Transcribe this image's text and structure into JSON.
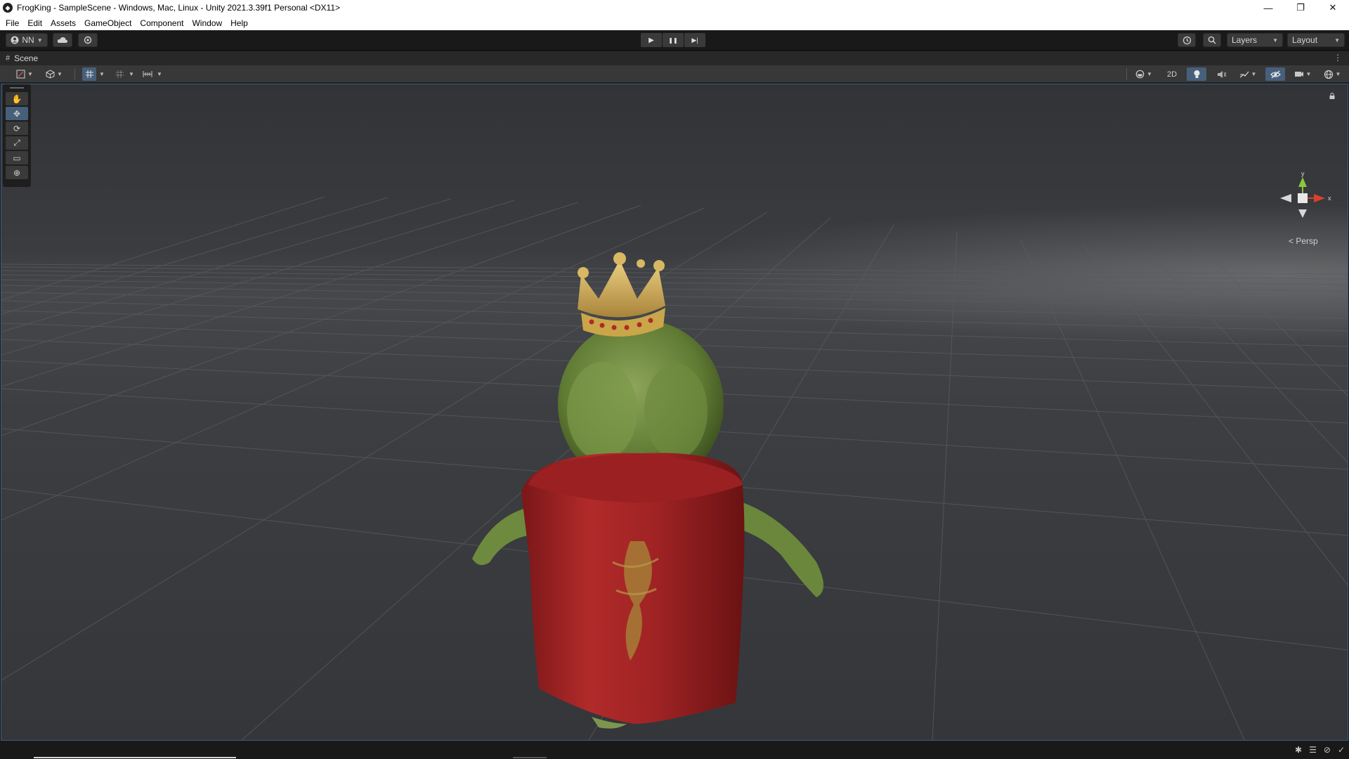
{
  "window": {
    "title": "FrogKing - SampleScene - Windows, Mac, Linux - Unity 2021.3.39f1 Personal <DX11>",
    "controls": {
      "minimize": "—",
      "restore": "❐",
      "close": "✕"
    }
  },
  "menu": [
    "File",
    "Edit",
    "Assets",
    "GameObject",
    "Component",
    "Window",
    "Help"
  ],
  "toolbar": {
    "account_label": "NN",
    "play_icons": {
      "play": "▶",
      "pause": "❚❚",
      "step": "▶|"
    },
    "layers_label": "Layers",
    "layout_label": "Layout"
  },
  "scene_tab": {
    "label": "Scene"
  },
  "scene_toolbar": {
    "mode_2d": "2D"
  },
  "tools": [
    "hand-tool",
    "move-tool",
    "rotate-tool",
    "scale-tool",
    "rect-tool",
    "transform-tool"
  ],
  "tool_glyphs": [
    "✋",
    "✥",
    "⟳",
    "⤢",
    "▭",
    "⊕"
  ],
  "active_tool": "move-tool",
  "gizmo": {
    "y_label": "y",
    "x_label": "x",
    "projection_label": "< Persp"
  },
  "colors": {
    "accent": "#46607c",
    "gizmo_y": "#8ec63f",
    "gizmo_x": "#d9412b",
    "cape": "#a52526",
    "frog": "#6e8a3e",
    "crown": "#c9a64a"
  }
}
